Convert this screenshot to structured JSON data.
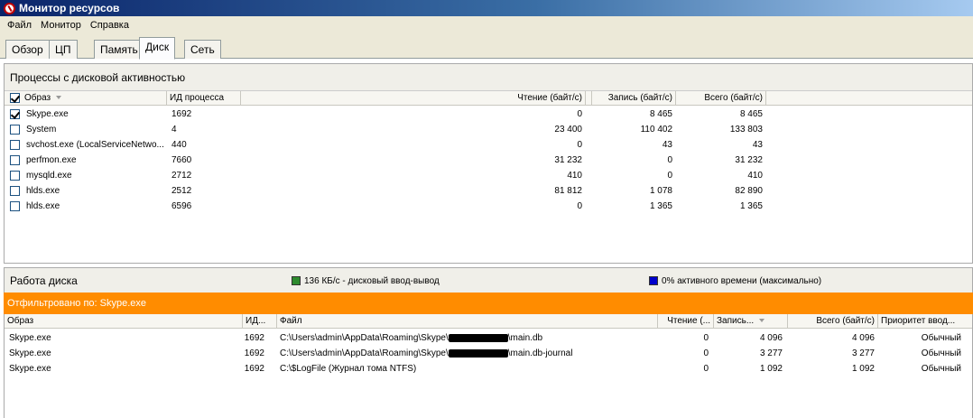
{
  "window": {
    "title": "Монитор ресурсов"
  },
  "menu": [
    "Файл",
    "Монитор",
    "Справка"
  ],
  "tabs": [
    {
      "label": "Обзор",
      "active": false
    },
    {
      "label": "ЦП",
      "active": false
    },
    {
      "label": "Память",
      "active": false
    },
    {
      "label": "Диск",
      "active": true
    },
    {
      "label": "Сеть",
      "active": false
    }
  ],
  "processes": {
    "title": "Процессы с дисковой активностью",
    "columns": [
      "Образ",
      "ИД процесса",
      "Чтение (байт/с)",
      "Запись (байт/с)",
      "Всего (байт/с)"
    ],
    "rows": [
      {
        "checked": true,
        "image": "Skype.exe",
        "pid": "1692",
        "read": "0",
        "write": "8 465",
        "total": "8 465"
      },
      {
        "checked": false,
        "image": "System",
        "pid": "4",
        "read": "23 400",
        "write": "110 402",
        "total": "133 803"
      },
      {
        "checked": false,
        "image": "svchost.exe (LocalServiceNetwo...",
        "pid": "440",
        "read": "0",
        "write": "43",
        "total": "43"
      },
      {
        "checked": false,
        "image": "perfmon.exe",
        "pid": "7660",
        "read": "31 232",
        "write": "0",
        "total": "31 232"
      },
      {
        "checked": false,
        "image": "mysqld.exe",
        "pid": "2712",
        "read": "410",
        "write": "0",
        "total": "410"
      },
      {
        "checked": false,
        "image": "hlds.exe",
        "pid": "2512",
        "read": "81 812",
        "write": "1 078",
        "total": "82 890"
      },
      {
        "checked": false,
        "image": "hlds.exe",
        "pid": "6596",
        "read": "0",
        "write": "1 365",
        "total": "1 365"
      }
    ]
  },
  "disk_activity": {
    "title": "Работа диска",
    "legend_io": "136 КБ/с - дисковый ввод-вывод",
    "legend_io_color": "#2e8b2e",
    "legend_active": "0% активного времени (максимально)",
    "legend_active_color": "#0000cc",
    "filter_label": "Отфильтровано по: Skype.exe",
    "filter_color": "#ff8c00",
    "columns": [
      "Образ",
      "ИД...",
      "Файл",
      "Чтение (...",
      "Запись...",
      "Всего (байт/с)",
      "Приоритет ввод..."
    ],
    "rows": [
      {
        "image": "Skype.exe",
        "pid": "1692",
        "file_pre": "C:\\Users\\admin\\AppData\\Roaming\\Skype\\",
        "file_post": "\\main.db",
        "redacted": true,
        "read": "0",
        "write": "4 096",
        "total": "4 096",
        "priority": "Обычный"
      },
      {
        "image": "Skype.exe",
        "pid": "1692",
        "file_pre": "C:\\Users\\admin\\AppData\\Roaming\\Skype\\",
        "file_post": "\\main.db-journal",
        "redacted": true,
        "read": "0",
        "write": "3 277",
        "total": "3 277",
        "priority": "Обычный"
      },
      {
        "image": "Skype.exe",
        "pid": "1692",
        "file_pre": "C:\\$LogFile (Журнал тома NTFS)",
        "file_post": "",
        "redacted": false,
        "read": "0",
        "write": "1 092",
        "total": "1 092",
        "priority": "Обычный"
      }
    ]
  }
}
